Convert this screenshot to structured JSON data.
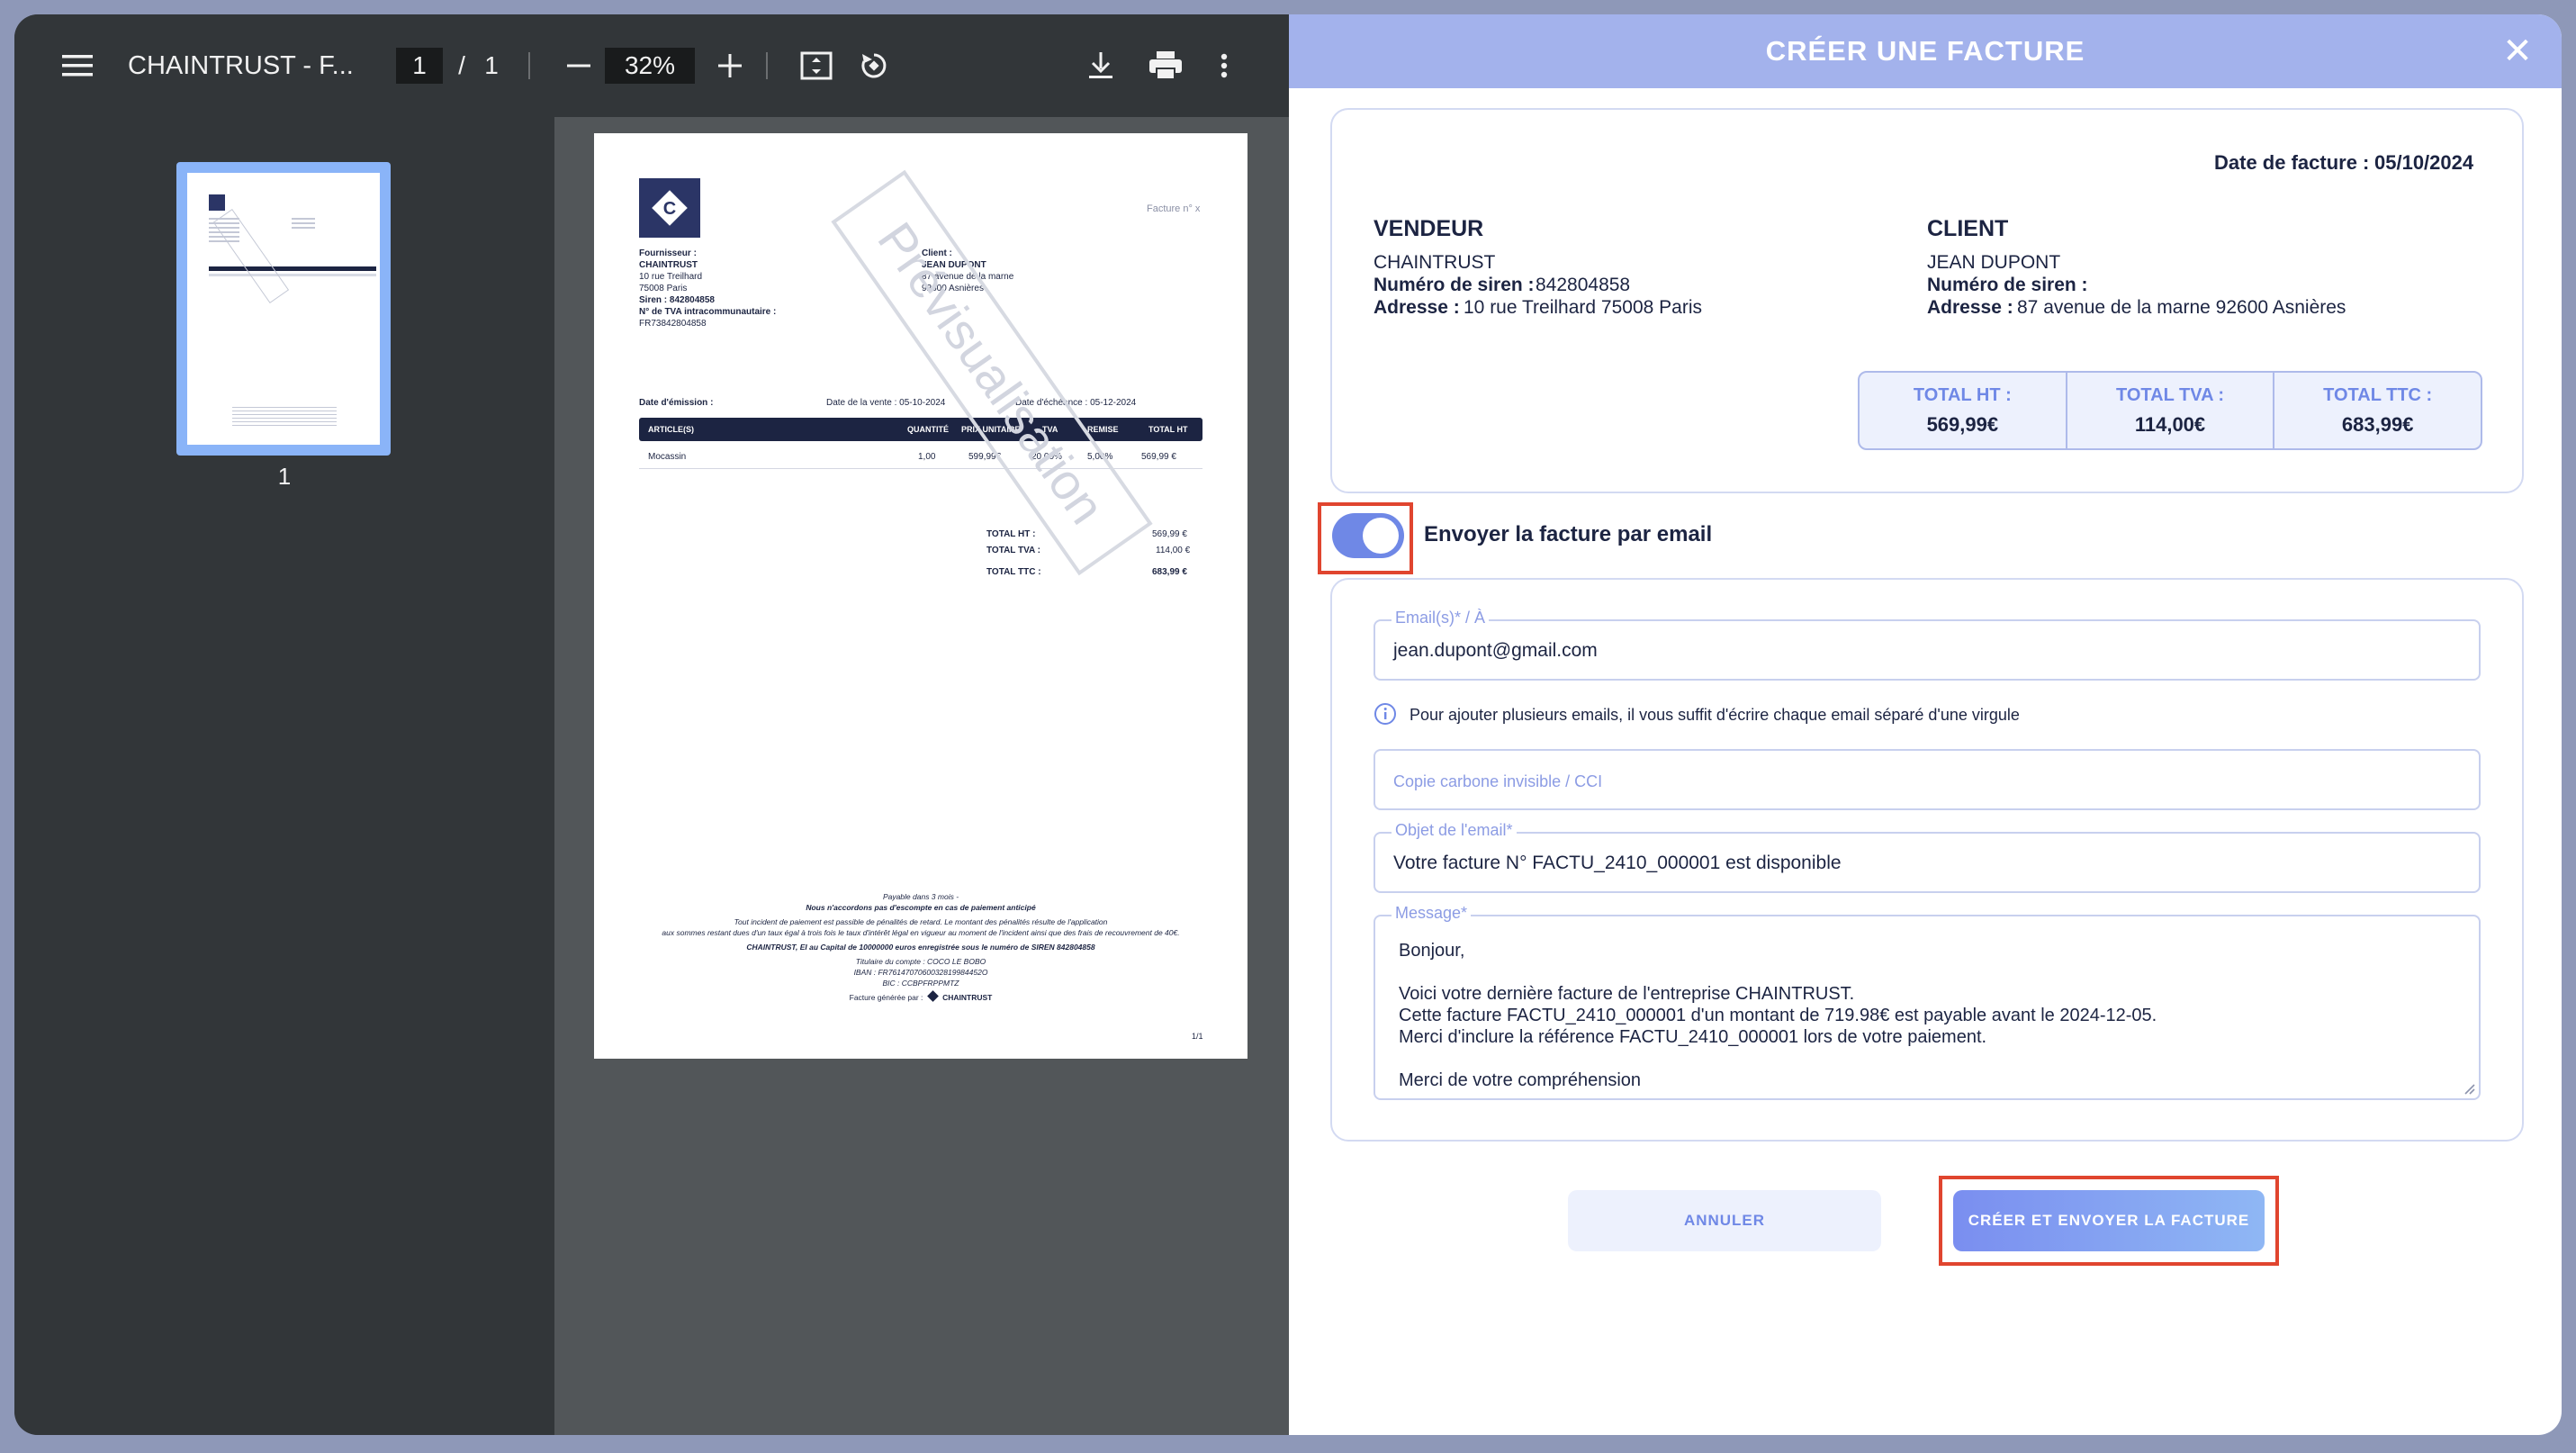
{
  "viewer": {
    "title": "CHAINTRUST - F...",
    "page_current": "1",
    "page_sep": "/",
    "page_total": "1",
    "zoom": "32%",
    "thumb_label": "1"
  },
  "pdf": {
    "invoice_no": "Facture n° x",
    "watermark": "Prévisualisation",
    "supplier_heading": "Fournisseur :",
    "supplier_name": "CHAINTRUST",
    "supplier_addr1": "10 rue Treilhard",
    "supplier_addr2": "75008 Paris",
    "supplier_siren": "Siren : 842804858",
    "supplier_tva_label": "N° de TVA intracommunautaire :",
    "supplier_tva": "FR73842804858",
    "client_heading": "Client :",
    "client_name": "JEAN DUPONT",
    "client_addr1": "87 avenue de la marne",
    "client_addr2": "92600 Asnières",
    "date_emission": "Date d'émission :",
    "date_vente": "Date de la vente : 05-10-2024",
    "date_echeance": "Date d'échéance : 05-12-2024",
    "table_headers": [
      "ARTICLE(S)",
      "QUANTITÉ",
      "PRIX UNITAIRE",
      "TVA",
      "REMISE",
      "TOTAL HT"
    ],
    "row": [
      "Mocassin",
      "1,00",
      "599,99€",
      "20,00%",
      "5,00%",
      "569,99 €"
    ],
    "tot_ht_label": "TOTAL HT :",
    "tot_ht": "569,99 €",
    "tot_tva_label": "TOTAL TVA :",
    "tot_tva": "114,00 €",
    "tot_ttc_label": "TOTAL TTC :",
    "tot_ttc": "683,99 €",
    "foot1": "Payable dans 3 mois -",
    "foot2": "Nous n'accordons pas d'escompte en cas de paiement anticipé",
    "foot3": "Tout incident de paiement est passible de pénalités de retard. Le montant des pénalités résulte de l'application",
    "foot4": "aux sommes restant dues d'un taux égal à trois fois le taux d'intérêt légal en vigueur au moment de l'incident ainsi que des frais de recouvrement de 40€.",
    "foot5": "CHAINTRUST, EI au Capital de 10000000 euros enregistrée sous le numéro de SIREN 842804858",
    "foot6": "Titulaire du compte : COCO LE BOBO",
    "foot7": "IBAN : FR7614707060032819984452O",
    "foot8": "BIC : CCBPFRPPMTZ",
    "foot9": "Facture générée par :",
    "foot_brand": "CHAINTRUST",
    "page_no": "1/1"
  },
  "modal": {
    "title": "CRÉER UNE FACTURE",
    "close": "✕",
    "date_label": "Date de facture  :",
    "date_value": "05/10/2024",
    "seller_heading": "VENDEUR",
    "seller_name": "CHAINTRUST",
    "seller_siren_label": "Numéro de siren :",
    "seller_siren": "842804858",
    "seller_addr_label": "Adresse :",
    "seller_addr": "10 rue Treilhard 75008 Paris",
    "client_heading": "CLIENT",
    "client_name": "JEAN DUPONT",
    "client_siren_label": "Numéro de siren :",
    "client_addr_label": "Adresse :",
    "client_addr": "87 avenue de la marne 92600 Asnières",
    "totals": [
      {
        "label": "TOTAL HT :",
        "value": "569,99€"
      },
      {
        "label": "TOTAL TVA :",
        "value": "114,00€"
      },
      {
        "label": "TOTAL TTC :",
        "value": "683,99€"
      }
    ],
    "toggle_label": "Envoyer la facture par email",
    "toggle_on": true,
    "email_label": "Email(s)* / À",
    "email_value": "jean.dupont@gmail.com",
    "email_hint": "Pour ajouter plusieurs emails, il vous suffit d'écrire chaque email séparé d'une virgule",
    "cci_placeholder": "Copie carbone invisible / CCI",
    "subject_label": "Objet de l'email*",
    "subject_value": "Votre facture N° FACTU_2410_000001 est disponible",
    "message_label": "Message*",
    "message_lines": [
      "Bonjour,",
      "",
      "Voici votre dernière facture de l'entreprise CHAINTRUST.",
      "Cette facture FACTU_2410_000001 d'un montant de 719.98€ est payable avant le 2024-12-05.",
      "Merci d'inclure la référence FACTU_2410_000001 lors de votre paiement.",
      "",
      "Merci de votre compréhension"
    ],
    "cancel_label": "ANNULER",
    "submit_label": "CRÉER ET ENVOYER LA FACTURE"
  },
  "colors": {
    "accent": "#6f88e6",
    "header": "#a3b2ec",
    "highlight": "#e0452f",
    "navy": "#1c2442"
  }
}
